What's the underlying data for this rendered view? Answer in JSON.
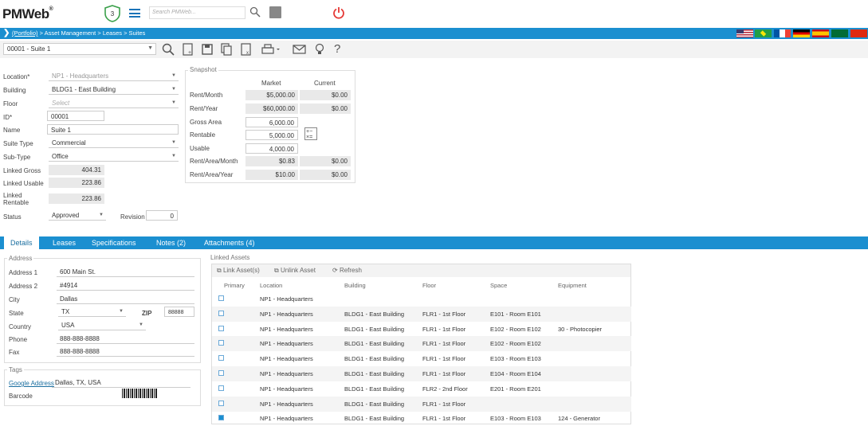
{
  "app": {
    "logo": "PMWeb",
    "notif_count": "3",
    "search_placeholder": "Search PMWeb..."
  },
  "breadcrumb": {
    "root": "(Portfolio)",
    "path": " > Asset Management > Leases > Suites"
  },
  "toolbar": {
    "record": "00001 - Suite 1"
  },
  "form": {
    "location_label": "Location*",
    "location": "NP1 - Headquarters",
    "building_label": "Building",
    "building": "BLDG1 - East Building",
    "floor_label": "Floor",
    "floor_placeholder": "Select",
    "id_label": "ID*",
    "id": "00001",
    "name_label": "Name",
    "name": "Suite 1",
    "suite_type_label": "Suite Type",
    "suite_type": "Commercial",
    "sub_type_label": "Sub-Type",
    "sub_type": "Office",
    "linked_gross_label": "Linked Gross",
    "linked_gross": "404.31",
    "linked_usable_label": "Linked Usable",
    "linked_usable": "223.86",
    "linked_rentable_label1": "Linked",
    "linked_rentable_label2": "Rentable",
    "linked_rentable": "223.86",
    "status_label": "Status",
    "status": "Approved",
    "revision_label": "Revision",
    "revision": "0"
  },
  "snapshot": {
    "title": "Snapshot",
    "col_market": "Market",
    "col_current": "Current",
    "rows": [
      {
        "label": "Rent/Month",
        "market": "$5,000.00",
        "current": "$0.00"
      },
      {
        "label": "Rent/Year",
        "market": "$60,000.00",
        "current": "$0.00"
      },
      {
        "label": "Gross Area",
        "market": "6,000.00",
        "current": ""
      },
      {
        "label": "Rentable",
        "market": "5,000.00",
        "current": ""
      },
      {
        "label": "Usable",
        "market": "4,000.00",
        "current": ""
      },
      {
        "label": "Rent/Area/Month",
        "market": "$0.83",
        "current": "$0.00"
      },
      {
        "label": "Rent/Area/Year",
        "market": "$10.00",
        "current": "$0.00"
      }
    ]
  },
  "tabs": [
    "Details",
    "Leases",
    "Specifications",
    "Notes (2)",
    "Attachments (4)"
  ],
  "address": {
    "title": "Address",
    "address1_label": "Address 1",
    "address1": "600 Main St.",
    "address2_label": "Address 2",
    "address2": "#4914",
    "city_label": "City",
    "city": "Dallas",
    "state_label": "State",
    "state": "TX",
    "zip_label": "ZIP",
    "zip": "88888",
    "country_label": "Country",
    "country": "USA",
    "phone_label": "Phone",
    "phone": "888-888-8888",
    "fax_label": "Fax",
    "fax": "888-888-8888"
  },
  "tags": {
    "title": "Tags",
    "google_label": "Google Address",
    "google": "Dallas, TX, USA",
    "barcode_label": "Barcode"
  },
  "linked_assets": {
    "title": "Linked Assets",
    "link_label": "Link Asset(s)",
    "unlink_label": "Unlink Asset",
    "refresh_label": "Refresh",
    "headers": [
      "Primary",
      "Location",
      "Building",
      "Floor",
      "Space",
      "Equipment"
    ],
    "rows": [
      {
        "primary": false,
        "location": "NP1 - Headquarters",
        "building": "",
        "floor": "",
        "space": "",
        "equipment": ""
      },
      {
        "primary": false,
        "location": "NP1 - Headquarters",
        "building": "BLDG1 - East Building",
        "floor": "FLR1 - 1st Floor",
        "space": "E101 - Room E101",
        "equipment": ""
      },
      {
        "primary": false,
        "location": "NP1 - Headquarters",
        "building": "BLDG1 - East Building",
        "floor": "FLR1 - 1st Floor",
        "space": "E102 - Room E102",
        "equipment": "30 - Photocopier"
      },
      {
        "primary": false,
        "location": "NP1 - Headquarters",
        "building": "BLDG1 - East Building",
        "floor": "FLR1 - 1st Floor",
        "space": "E102 - Room E102",
        "equipment": ""
      },
      {
        "primary": false,
        "location": "NP1 - Headquarters",
        "building": "BLDG1 - East Building",
        "floor": "FLR1 - 1st Floor",
        "space": "E103 - Room E103",
        "equipment": ""
      },
      {
        "primary": false,
        "location": "NP1 - Headquarters",
        "building": "BLDG1 - East Building",
        "floor": "FLR1 - 1st Floor",
        "space": "E104 - Room E104",
        "equipment": ""
      },
      {
        "primary": false,
        "location": "NP1 - Headquarters",
        "building": "BLDG1 - East Building",
        "floor": "FLR2 - 2nd Floor",
        "space": "E201 - Room E201",
        "equipment": ""
      },
      {
        "primary": false,
        "location": "NP1 - Headquarters",
        "building": "BLDG1 - East Building",
        "floor": "FLR1 - 1st Floor",
        "space": "",
        "equipment": ""
      },
      {
        "primary": true,
        "location": "NP1 - Headquarters",
        "building": "BLDG1 - East Building",
        "floor": "FLR1 - 1st Floor",
        "space": "E103 - Room E103",
        "equipment": "124 - Generator"
      }
    ]
  },
  "colors": {
    "accent": "#1b8fd0",
    "power": "#e53935"
  }
}
